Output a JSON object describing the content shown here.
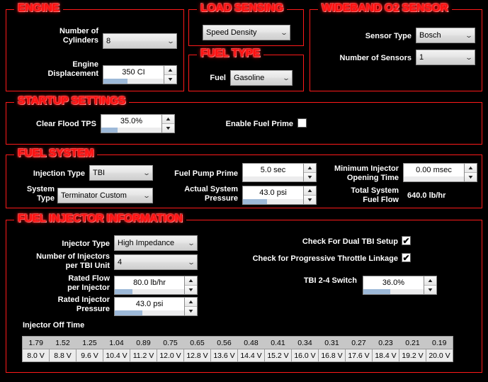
{
  "sections": {
    "engine": {
      "title": "ENGINE",
      "fields": {
        "cylinders_label": "Number of\nCylinders",
        "cylinders_value": "8",
        "displacement_label": "Engine\nDisplacement",
        "displacement_value": "350 CI"
      }
    },
    "load_sensing": {
      "title": "LOAD SENSING",
      "fields": {
        "load_value": "Speed Density"
      }
    },
    "fuel_type": {
      "title": "FUEL TYPE",
      "fields": {
        "fuel_label": "Fuel",
        "fuel_value": "Gasoline"
      }
    },
    "wideband_o2": {
      "title": "WIDEBAND O2 SENSOR",
      "fields": {
        "sensor_type_label": "Sensor Type",
        "sensor_type_value": "Bosch",
        "number_of_sensors_label": "Number of Sensors",
        "number_of_sensors_value": "1"
      }
    },
    "startup_settings": {
      "title": "STARTUP SETTINGS",
      "fields": {
        "clear_flood_tps_label": "Clear Flood TPS",
        "clear_flood_tps_value": "35.0%",
        "enable_fuel_prime_label": "Enable Fuel Prime",
        "enable_fuel_prime_checked": ""
      }
    },
    "fuel_system": {
      "title": "FUEL SYSTEM",
      "fields": {
        "injection_type_label": "Injection Type",
        "injection_type_value": "TBI",
        "system_type_label": "System\nType",
        "system_type_value": "Terminator Custom",
        "fuel_pump_prime_label": "Fuel Pump Prime",
        "fuel_pump_prime_value": "5.0 sec",
        "actual_system_pressure_label": "Actual System\nPressure",
        "actual_system_pressure_value": "43.0 psi",
        "minimum_injector_opening_time_label": "Minimum Injector\nOpening Time",
        "minimum_injector_opening_time_value": "0.00 msec",
        "total_system_fuel_flow_label": "Total System\nFuel Flow",
        "total_system_fuel_flow_value": "640.0 lb/hr"
      }
    },
    "fuel_injector_information": {
      "title": "FUEL INJECTOR INFORMATION",
      "fields": {
        "injector_type_label": "Injector Type",
        "injector_type_value": "High Impedance",
        "injectors_per_tbi_label": "Number of Injectors\nper TBI Unit",
        "injectors_per_tbi_value": "4",
        "rated_flow_label": "Rated Flow\nper Injector",
        "rated_flow_value": "80.0 lb/hr",
        "rated_injector_pressure_label": "Rated Injector\nPressure",
        "rated_injector_pressure_value": "43.0 psi",
        "check_dual_tbi_label": "Check For Dual TBI Setup",
        "check_dual_tbi_checked": "✔",
        "check_progressive_label": "Check for Progressive Throttle Linkage",
        "check_progressive_checked": "✔",
        "tbi_switch_label": "TBI 2-4 Switch",
        "tbi_switch_value": "36.0%",
        "injector_off_time_label": "Injector Off Time"
      },
      "injector_off_time_table": {
        "times": [
          "1.79",
          "1.52",
          "1.25",
          "1.04",
          "0.89",
          "0.75",
          "0.65",
          "0.56",
          "0.48",
          "0.41",
          "0.34",
          "0.31",
          "0.27",
          "0.23",
          "0.21",
          "0.19"
        ],
        "volts": [
          "8.0 V",
          "8.8 V",
          "9.6 V",
          "10.4 V",
          "11.2 V",
          "12.0 V",
          "12.8 V",
          "13.6 V",
          "14.4 V",
          "15.2 V",
          "16.0 V",
          "16.8 V",
          "17.6 V",
          "18.4 V",
          "19.2 V",
          "20.0 V"
        ]
      }
    }
  },
  "icons": {
    "chevron_down": "⌄",
    "arrow_up": "▲",
    "arrow_down": "▼"
  },
  "colors": {
    "accent_red": "#ff1111",
    "background": "#000000",
    "progress_blue": "#9db9d8"
  },
  "spinner_fills": {
    "displacement_pct": 40,
    "clear_flood_pct": 27,
    "actual_pressure_pct": 40,
    "rated_flow_pct": 25,
    "rated_pressure_pct": 40,
    "tbi_switch_pct": 45,
    "fuel_pump_prime_pct": 0,
    "min_injector_pct": 0
  }
}
